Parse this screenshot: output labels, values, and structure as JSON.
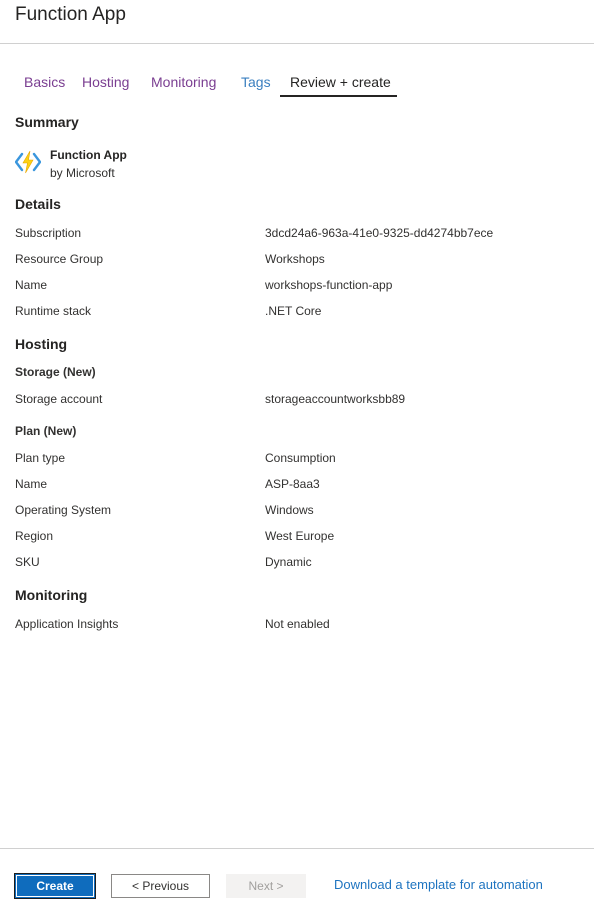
{
  "header": {
    "title": "Function App"
  },
  "tabs": [
    {
      "label": "Basics"
    },
    {
      "label": "Hosting"
    },
    {
      "label": "Monitoring"
    },
    {
      "label": "Tags"
    },
    {
      "label": "Review + create"
    }
  ],
  "summary": {
    "heading": "Summary",
    "app_name": "Function App",
    "app_publisher": "by Microsoft",
    "icon": "function-lightning-icon",
    "icon_colors": {
      "bracket": "#3a96dd",
      "bolt": "#fcd116"
    }
  },
  "details": {
    "heading": "Details",
    "rows": [
      {
        "key": "Subscription",
        "value": "3dcd24a6-963a-41e0-9325-dd4274bb7ece"
      },
      {
        "key": "Resource Group",
        "value": "Workshops"
      },
      {
        "key": "Name",
        "value": "workshops-function-app"
      },
      {
        "key": "Runtime stack",
        "value": ".NET Core"
      }
    ]
  },
  "hosting": {
    "heading": "Hosting",
    "storage_heading": "Storage (New)",
    "storage_rows": [
      {
        "key": "Storage account",
        "value": "storageaccountworksbb89"
      }
    ],
    "plan_heading": "Plan (New)",
    "plan_rows": [
      {
        "key": "Plan type",
        "value": "Consumption"
      },
      {
        "key": "Name",
        "value": "ASP-8aa3"
      },
      {
        "key": "Operating System",
        "value": "Windows"
      },
      {
        "key": "Region",
        "value": "West Europe"
      },
      {
        "key": "SKU",
        "value": "Dynamic"
      }
    ]
  },
  "monitoring": {
    "heading": "Monitoring",
    "rows": [
      {
        "key": "Application Insights",
        "value": "Not enabled"
      }
    ]
  },
  "footer": {
    "create_label": "Create",
    "previous_label": "< Previous",
    "next_label": "Next >",
    "download_link": "Download a template for automation"
  },
  "colors": {
    "primary_button": "#0f6cbd",
    "link": "#1e74c0",
    "visited_tab": "#7a3e91"
  }
}
